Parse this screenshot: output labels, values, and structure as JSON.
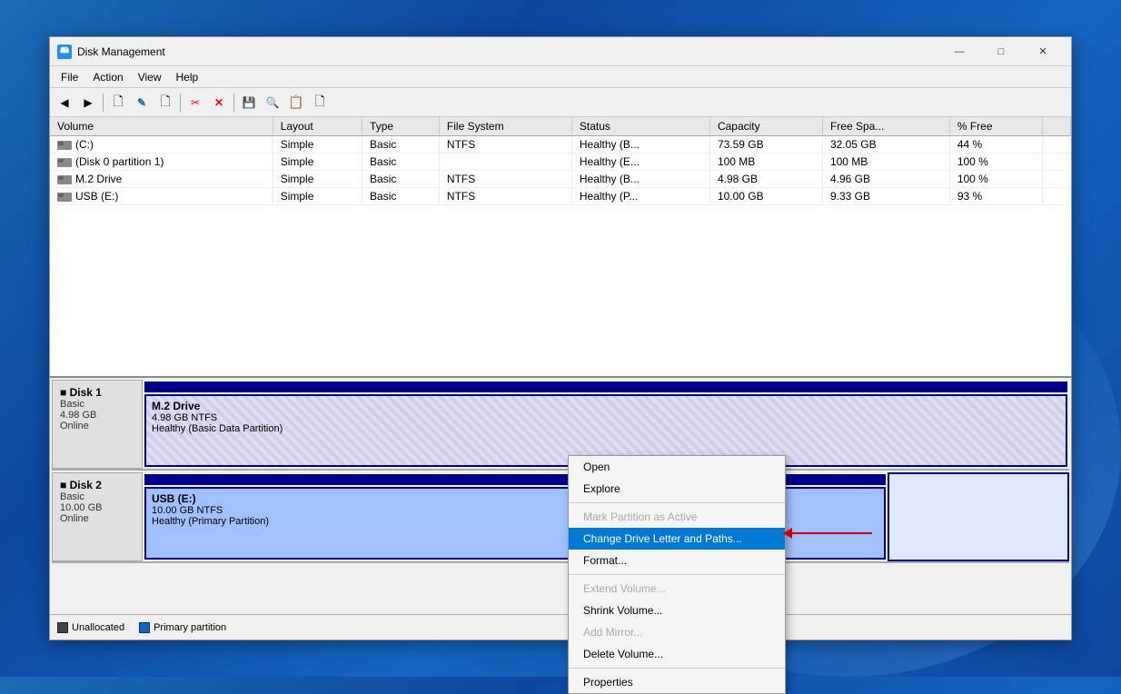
{
  "window": {
    "title": "Disk Management",
    "icon": "💾"
  },
  "window_controls": {
    "minimize": "—",
    "maximize": "□",
    "close": "✕"
  },
  "menu": {
    "items": [
      "File",
      "Action",
      "View",
      "Help"
    ]
  },
  "toolbar": {
    "buttons": [
      "◀",
      "▶",
      "📄",
      "✏",
      "📄",
      "✂",
      "❌",
      "💾",
      "🔍",
      "📋",
      "📄"
    ]
  },
  "table": {
    "columns": [
      "Volume",
      "Layout",
      "Type",
      "File System",
      "Status",
      "Capacity",
      "Free Spa...",
      "% Free"
    ],
    "rows": [
      {
        "volume": "(C:)",
        "layout": "Simple",
        "type": "Basic",
        "fs": "NTFS",
        "status": "Healthy (B...",
        "capacity": "73.59 GB",
        "free": "32.05 GB",
        "pct": "44 %"
      },
      {
        "volume": "(Disk 0 partition 1)",
        "layout": "Simple",
        "type": "Basic",
        "fs": "",
        "status": "Healthy (E...",
        "capacity": "100 MB",
        "free": "100 MB",
        "pct": "100 %"
      },
      {
        "volume": "M.2 Drive",
        "layout": "Simple",
        "type": "Basic",
        "fs": "NTFS",
        "status": "Healthy (B...",
        "capacity": "4.98 GB",
        "free": "4.96 GB",
        "pct": "100 %"
      },
      {
        "volume": "USB (E:)",
        "layout": "Simple",
        "type": "Basic",
        "fs": "NTFS",
        "status": "Healthy (P...",
        "capacity": "10.00 GB",
        "free": "9.33 GB",
        "pct": "93 %"
      }
    ]
  },
  "disks": [
    {
      "name": "Disk 1",
      "type": "Basic",
      "size": "4.98 GB",
      "status": "Online",
      "partitions": [
        {
          "name": "M.2 Drive",
          "size": "4.98 GB NTFS",
          "status": "Healthy (Basic Data Partition)"
        }
      ]
    },
    {
      "name": "Disk 2",
      "type": "Basic",
      "size": "10.00 GB",
      "status": "Online",
      "partitions": [
        {
          "name": "USB  (E:)",
          "size": "10.00 GB NTFS",
          "status": "Healthy (Primary Partition)"
        }
      ]
    }
  ],
  "legend": {
    "items": [
      {
        "label": "Unallocated",
        "color": "#444"
      },
      {
        "label": "Primary partition",
        "color": "#1565c0"
      }
    ]
  },
  "context_menu": {
    "items": [
      {
        "label": "Open",
        "enabled": true
      },
      {
        "label": "Explore",
        "enabled": true
      },
      {
        "separator": true
      },
      {
        "label": "Mark Partition as Active",
        "enabled": false
      },
      {
        "label": "Change Drive Letter and Paths...",
        "enabled": true,
        "highlighted": true
      },
      {
        "label": "Format...",
        "enabled": true
      },
      {
        "separator": true
      },
      {
        "label": "Extend Volume...",
        "enabled": false
      },
      {
        "label": "Shrink Volume...",
        "enabled": true
      },
      {
        "label": "Add Mirror...",
        "enabled": false
      },
      {
        "label": "Delete Volume...",
        "enabled": true
      },
      {
        "separator": true
      },
      {
        "label": "Properties",
        "enabled": true
      }
    ]
  }
}
